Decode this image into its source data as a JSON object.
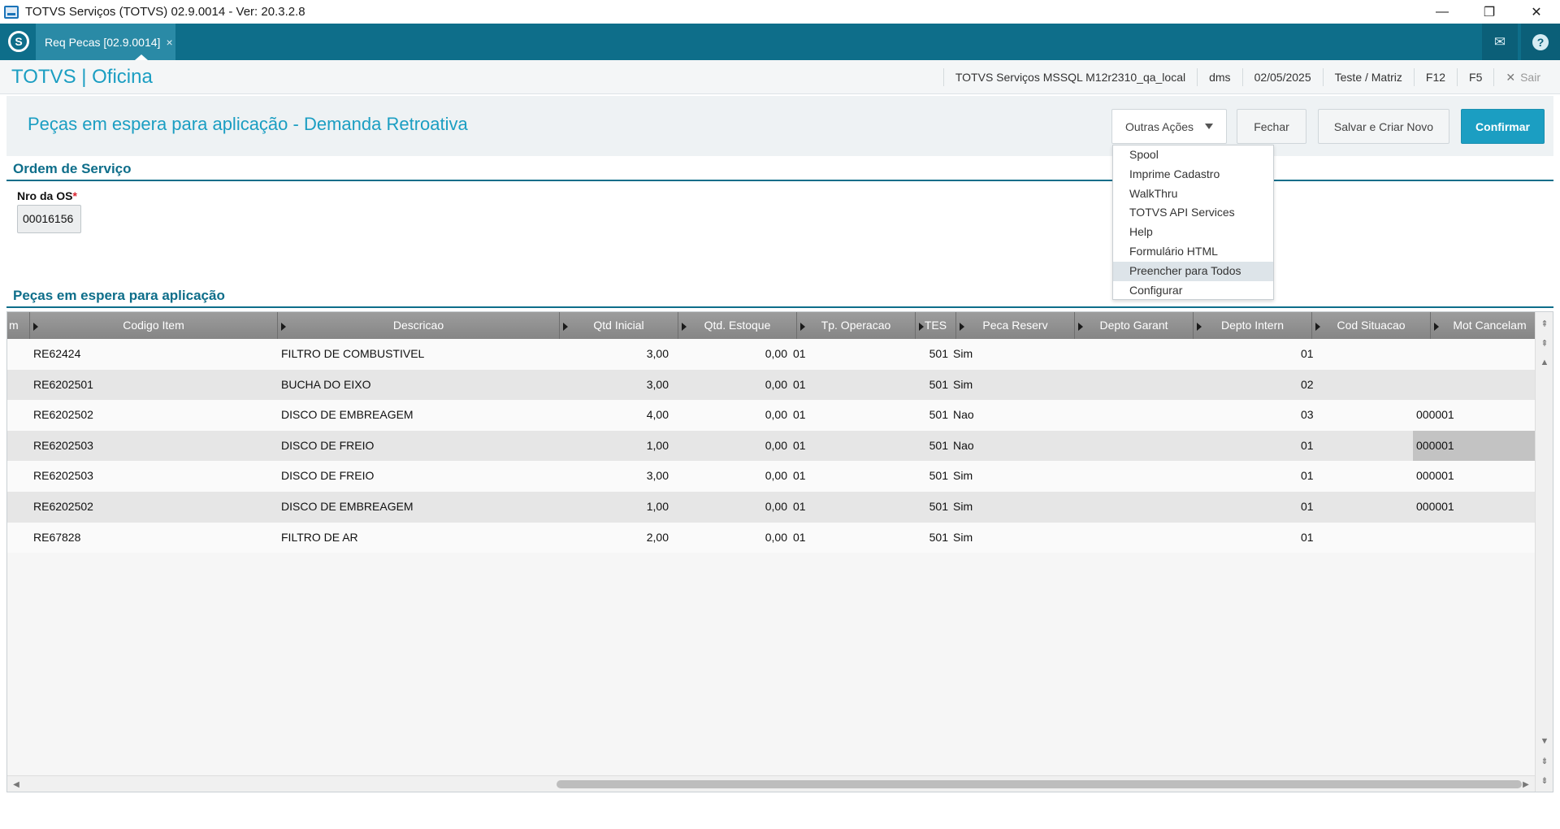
{
  "window": {
    "title": "TOTVS Serviços (TOTVS) 02.9.0014 - Ver: 20.3.2.8",
    "minimize": "—",
    "restore": "❐",
    "close": "✕"
  },
  "tabbar": {
    "tab_label": "Req Pecas [02.9.0014]",
    "tab_close": "×",
    "mail_icon": "✉",
    "help_icon": "?"
  },
  "appbar": {
    "brand": "TOTVS | Oficina",
    "environment": "TOTVS Serviços MSSQL M12r2310_qa_local",
    "module": "dms",
    "date": "02/05/2025",
    "company": "Teste / Matriz",
    "f12": "F12",
    "f5": "F5",
    "exit_icon": "✕",
    "exit_label": "Sair"
  },
  "header": {
    "page_title": "Peças em espera para aplicação - Demanda Retroativa",
    "buttons": {
      "outras_acoes": "Outras Ações",
      "fechar": "Fechar",
      "salvar_criar": "Salvar e Criar Novo",
      "confirmar": "Confirmar"
    },
    "accent_color": "#1b9ec2"
  },
  "dropdown": {
    "items": [
      "Spool",
      "Imprime Cadastro",
      "WalkThru",
      "TOTVS API Services",
      "Help",
      "Formulário HTML",
      "Preencher para Todos",
      "Configurar"
    ],
    "highlighted": "Preencher para Todos"
  },
  "ordem": {
    "section_title": "Ordem de Serviço",
    "field_label": "Nro da OS",
    "required_mark": "*",
    "field_value": "00016156"
  },
  "pecas": {
    "section_title": "Peças em espera para aplicação",
    "columns": [
      "m",
      "Codigo Item",
      "Descricao",
      "Qtd Inicial",
      "Qtd. Estoque",
      "Tp. Operacao",
      "TES",
      "Peca Reserv",
      "Depto Garant",
      "Depto Intern",
      "Cod Situacao",
      "Mot Cancelam"
    ],
    "rows": [
      [
        "RE62424",
        "FILTRO DE COMBUSTIVEL",
        "3,00",
        "0,00",
        "01",
        "501",
        "Sim",
        "",
        "",
        "01",
        ""
      ],
      [
        "RE6202501",
        "BUCHA DO EIXO",
        "3,00",
        "0,00",
        "01",
        "501",
        "Sim",
        "",
        "",
        "02",
        ""
      ],
      [
        "RE6202502",
        "DISCO DE EMBREAGEM",
        "4,00",
        "0,00",
        "01",
        "501",
        "Nao",
        "",
        "",
        "03",
        "000001"
      ],
      [
        "RE6202503",
        "DISCO DE FREIO",
        "1,00",
        "0,00",
        "01",
        "501",
        "Nao",
        "",
        "",
        "01",
        "000001"
      ],
      [
        "RE6202503",
        "DISCO DE FREIO",
        "3,00",
        "0,00",
        "01",
        "501",
        "Sim",
        "",
        "",
        "01",
        "000001"
      ],
      [
        "RE6202502",
        "DISCO DE EMBREAGEM",
        "1,00",
        "0,00",
        "01",
        "501",
        "Sim",
        "",
        "",
        "01",
        "000001"
      ],
      [
        "RE67828",
        "FILTRO DE AR",
        "2,00",
        "0,00",
        "01",
        "501",
        "Sim",
        "",
        "",
        "01",
        ""
      ]
    ],
    "selected_cell": {
      "row": 3,
      "col": 10
    }
  },
  "scroll": {
    "up": "▲",
    "down": "▼",
    "left": "◀",
    "right": "▶",
    "page_up": "⇞",
    "page_down": "⇟"
  }
}
